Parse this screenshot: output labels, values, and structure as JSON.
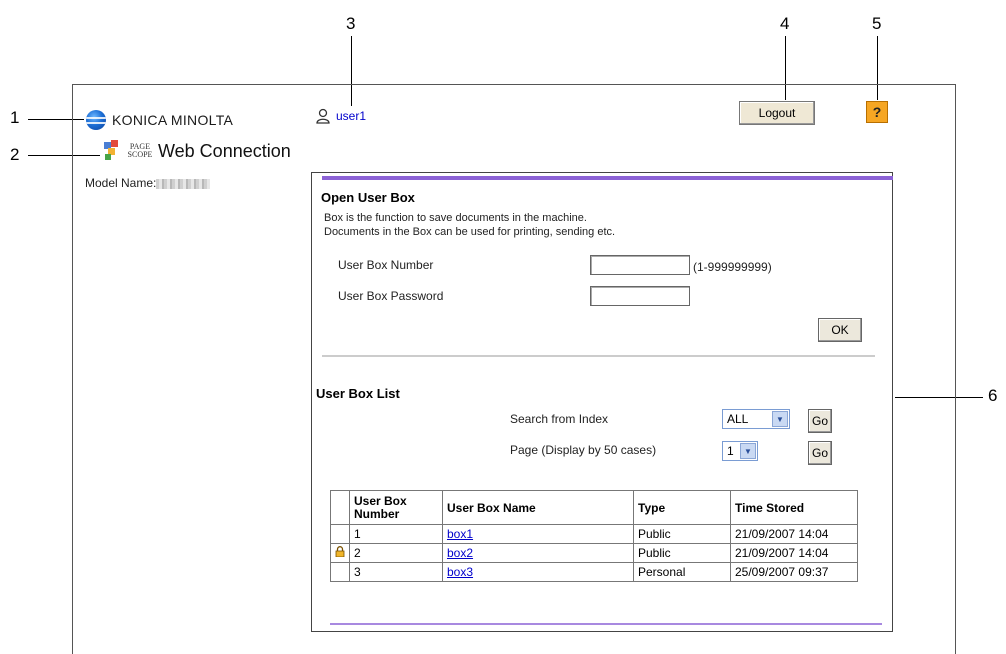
{
  "callouts": [
    "1",
    "2",
    "3",
    "4",
    "5",
    "6"
  ],
  "header": {
    "brand": "KONICA MINOLTA",
    "product_prefix": "PAGE SCOPE",
    "product": "Web Connection",
    "model_label": "Model Name:",
    "user": "user1",
    "logout_label": "Logout",
    "help_label": "?"
  },
  "open_box": {
    "title": "Open User Box",
    "desc_line1": "Box is the function to save documents in the machine.",
    "desc_line2": "Documents in the Box can be used for printing, sending etc.",
    "number_label": "User Box Number",
    "number_value": "",
    "number_range": "(1-999999999)",
    "password_label": "User Box Password",
    "password_value": "",
    "ok_label": "OK"
  },
  "box_list": {
    "title": "User Box List",
    "search_label": "Search from Index",
    "search_selected": "ALL",
    "go_label": "Go",
    "page_label": "Page (Display by 50 cases)",
    "page_selected": "1",
    "columns": [
      "User Box Number",
      "User Box Name",
      "Type",
      "Time Stored"
    ],
    "rows": [
      {
        "locked": false,
        "number": "1",
        "name": "box1",
        "type": "Public",
        "time": "21/09/2007 14:04"
      },
      {
        "locked": true,
        "number": "2",
        "name": "box2",
        "type": "Public",
        "time": "21/09/2007 14:04"
      },
      {
        "locked": false,
        "number": "3",
        "name": "box3",
        "type": "Personal",
        "time": "25/09/2007 09:37"
      }
    ]
  },
  "colors": {
    "accent_bar": "#8c62d6",
    "help_button": "#f6a623",
    "link": "#0000cc"
  }
}
